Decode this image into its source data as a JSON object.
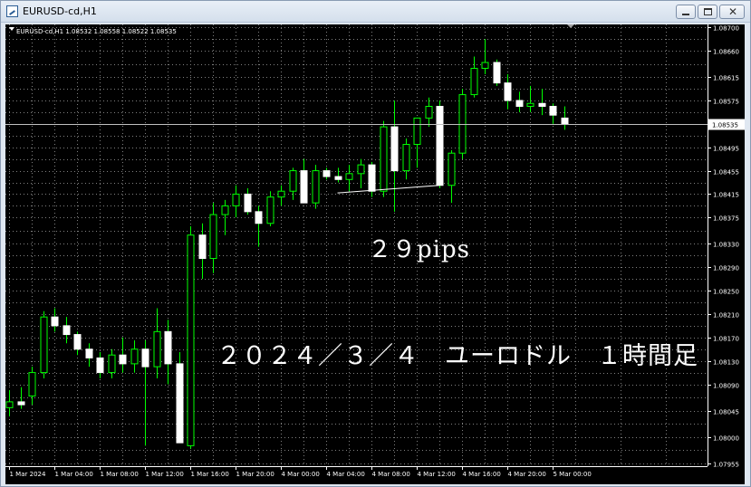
{
  "window": {
    "title": "EURUSD-cd,H1"
  },
  "chart": {
    "info_line": "EURUSD-cd,H1  1.08532 1.08558 1.08522 1.08535",
    "current_price": "1.08535",
    "annotations": {
      "pips": "２９pips",
      "caption": "２０２４／３／４　ユーロドル　１時間足"
    },
    "colors": {
      "background": "#000000",
      "grid": "#808080",
      "candle_up_body": "#000000",
      "candle_down_body": "#ffffff",
      "wick": "#00ff00",
      "text": "#ffffff"
    }
  },
  "chart_data": {
    "type": "candlestick",
    "y_ticks": [
      "1.08700",
      "1.08660",
      "1.08615",
      "1.08575",
      "1.08535",
      "1.08495",
      "1.08455",
      "1.08415",
      "1.08375",
      "1.08330",
      "1.08290",
      "1.08250",
      "1.08210",
      "1.08170",
      "1.08130",
      "1.08090",
      "1.08045",
      "1.08000",
      "1.07955"
    ],
    "x_ticks": [
      "1 Mar 2024",
      "1 Mar 04:00",
      "1 Mar 08:00",
      "1 Mar 12:00",
      "1 Mar 16:00",
      "1 Mar 20:00",
      "4 Mar 00:00",
      "4 Mar 04:00",
      "4 Mar 08:00",
      "4 Mar 12:00",
      "4 Mar 16:00",
      "4 Mar 20:00",
      "5 Mar 00:00"
    ],
    "ylim": [
      1.0795,
      1.08705
    ],
    "measure_line": {
      "from": [
        1.08417,
        "4 Mar 02:00"
      ],
      "to": [
        1.0843,
        "4 Mar 12:00"
      ],
      "pips": 29
    },
    "candles": [
      {
        "o": 1.0805,
        "h": 1.0808,
        "l": 1.08035,
        "c": 1.0806
      },
      {
        "o": 1.0806,
        "h": 1.08085,
        "l": 1.08048,
        "c": 1.08055
      },
      {
        "o": 1.0807,
        "h": 1.0812,
        "l": 1.08055,
        "c": 1.0811
      },
      {
        "o": 1.0811,
        "h": 1.08215,
        "l": 1.081,
        "c": 1.08205
      },
      {
        "o": 1.08205,
        "h": 1.0822,
        "l": 1.0818,
        "c": 1.0819
      },
      {
        "o": 1.0819,
        "h": 1.08205,
        "l": 1.0816,
        "c": 1.08175
      },
      {
        "o": 1.08175,
        "h": 1.0818,
        "l": 1.0814,
        "c": 1.0815
      },
      {
        "o": 1.0815,
        "h": 1.0816,
        "l": 1.0812,
        "c": 1.08135
      },
      {
        "o": 1.08135,
        "h": 1.08145,
        "l": 1.081,
        "c": 1.0811
      },
      {
        "o": 1.0811,
        "h": 1.0815,
        "l": 1.081,
        "c": 1.0814
      },
      {
        "o": 1.0814,
        "h": 1.0817,
        "l": 1.0811,
        "c": 1.08125
      },
      {
        "o": 1.08125,
        "h": 1.08165,
        "l": 1.0811,
        "c": 1.0815
      },
      {
        "o": 1.0815,
        "h": 1.08165,
        "l": 1.07985,
        "c": 1.0812
      },
      {
        "o": 1.0812,
        "h": 1.0822,
        "l": 1.081,
        "c": 1.0818
      },
      {
        "o": 1.0818,
        "h": 1.082,
        "l": 1.0809,
        "c": 1.08125
      },
      {
        "o": 1.08125,
        "h": 1.08145,
        "l": 1.0799,
        "c": 1.0799
      },
      {
        "o": 1.07985,
        "h": 1.0836,
        "l": 1.0798,
        "c": 1.08345
      },
      {
        "o": 1.08345,
        "h": 1.08365,
        "l": 1.0827,
        "c": 1.08305
      },
      {
        "o": 1.08305,
        "h": 1.084,
        "l": 1.0828,
        "c": 1.0838
      },
      {
        "o": 1.0838,
        "h": 1.08405,
        "l": 1.08345,
        "c": 1.08395
      },
      {
        "o": 1.08395,
        "h": 1.0843,
        "l": 1.08375,
        "c": 1.08415
      },
      {
        "o": 1.08415,
        "h": 1.08425,
        "l": 1.0838,
        "c": 1.08385
      },
      {
        "o": 1.08385,
        "h": 1.08395,
        "l": 1.08325,
        "c": 1.08365
      },
      {
        "o": 1.08365,
        "h": 1.0842,
        "l": 1.0836,
        "c": 1.0841
      },
      {
        "o": 1.0841,
        "h": 1.0843,
        "l": 1.08395,
        "c": 1.0842
      },
      {
        "o": 1.0842,
        "h": 1.0846,
        "l": 1.08405,
        "c": 1.08455
      },
      {
        "o": 1.08455,
        "h": 1.08475,
        "l": 1.0842,
        "c": 1.084
      },
      {
        "o": 1.084,
        "h": 1.08465,
        "l": 1.0839,
        "c": 1.08455
      },
      {
        "o": 1.08455,
        "h": 1.0846,
        "l": 1.0844,
        "c": 1.08445
      },
      {
        "o": 1.08445,
        "h": 1.0846,
        "l": 1.08435,
        "c": 1.0844
      },
      {
        "o": 1.0844,
        "h": 1.08465,
        "l": 1.0842,
        "c": 1.0845
      },
      {
        "o": 1.0845,
        "h": 1.08475,
        "l": 1.08425,
        "c": 1.08465
      },
      {
        "o": 1.08465,
        "h": 1.0847,
        "l": 1.0841,
        "c": 1.0842
      },
      {
        "o": 1.0842,
        "h": 1.0854,
        "l": 1.0841,
        "c": 1.0853
      },
      {
        "o": 1.0853,
        "h": 1.08575,
        "l": 1.08385,
        "c": 1.08455
      },
      {
        "o": 1.08455,
        "h": 1.0851,
        "l": 1.0844,
        "c": 1.085
      },
      {
        "o": 1.085,
        "h": 1.0854,
        "l": 1.0846,
        "c": 1.08545
      },
      {
        "o": 1.08545,
        "h": 1.0858,
        "l": 1.0853,
        "c": 1.08565
      },
      {
        "o": 1.08565,
        "h": 1.08575,
        "l": 1.08425,
        "c": 1.0843
      },
      {
        "o": 1.0843,
        "h": 1.0849,
        "l": 1.084,
        "c": 1.08485
      },
      {
        "o": 1.08485,
        "h": 1.08595,
        "l": 1.08475,
        "c": 1.08585
      },
      {
        "o": 1.08585,
        "h": 1.0865,
        "l": 1.0858,
        "c": 1.0863
      },
      {
        "o": 1.0863,
        "h": 1.0868,
        "l": 1.0862,
        "c": 1.0864
      },
      {
        "o": 1.0864,
        "h": 1.08645,
        "l": 1.086,
        "c": 1.08605
      },
      {
        "o": 1.08605,
        "h": 1.0862,
        "l": 1.0856,
        "c": 1.08575
      },
      {
        "o": 1.08575,
        "h": 1.0859,
        "l": 1.08555,
        "c": 1.08565
      },
      {
        "o": 1.08565,
        "h": 1.086,
        "l": 1.08555,
        "c": 1.0857
      },
      {
        "o": 1.0857,
        "h": 1.08595,
        "l": 1.0855,
        "c": 1.08565
      },
      {
        "o": 1.08565,
        "h": 1.0857,
        "l": 1.08535,
        "c": 1.0855
      },
      {
        "o": 1.08545,
        "h": 1.08565,
        "l": 1.08525,
        "c": 1.08535
      }
    ]
  }
}
